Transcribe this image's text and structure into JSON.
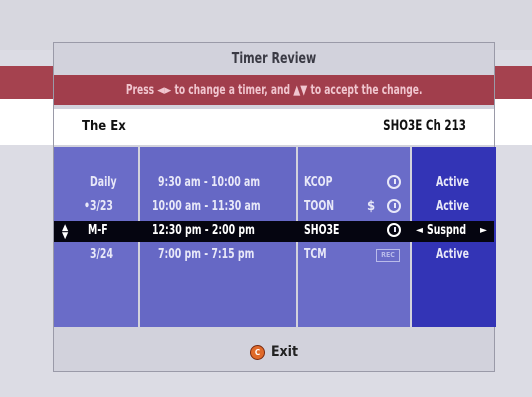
{
  "screen": {
    "title": "Timer Review",
    "instruction_pre": "Press",
    "instruction_mid": "to change a timer, and",
    "instruction_post": "to accept the change."
  },
  "selected_program": {
    "name": "The Ex",
    "channel": "SHO3E Ch 213"
  },
  "timers": [
    {
      "day": "Daily",
      "time": "9:30 am - 10:00 am",
      "station": "KCOP",
      "money": "",
      "icon": "timer-clock-icon",
      "status": "Active"
    },
    {
      "day": "•3/23",
      "time": "10:00 am - 11:30 am",
      "station": "TOON",
      "money": "$",
      "icon": "timer-clock-icon",
      "status": "Active"
    },
    {
      "day": "M-F",
      "time": "12:30 pm - 2:00 pm",
      "station": "SHO3E",
      "money": "",
      "icon": "timer-clock-icon",
      "status": "Suspnd"
    },
    {
      "day": "3/24",
      "time": "7:00 pm - 7:15 pm",
      "station": "TCM",
      "money": "",
      "icon": "rec-icon",
      "status": "Active"
    }
  ],
  "rec_label": "REC",
  "arrows": {
    "left_right": "◄►",
    "up_down": "▲▼",
    "up_down_small": "▲\n▼",
    "left": "◄",
    "right": "►"
  },
  "footer": {
    "exit_icon_glyph": "C",
    "exit_label": "Exit"
  },
  "colors": {
    "instruction_bar": "#a13e4c",
    "column_blue": "#6a6cc8",
    "status_column": "#3334b6",
    "selected_row": "#050510",
    "exit_button": "#e06a2a"
  }
}
